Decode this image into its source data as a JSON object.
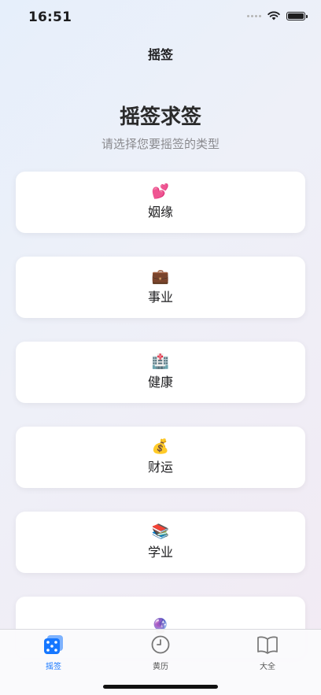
{
  "status_bar": {
    "time": "16:51"
  },
  "nav": {
    "title": "摇签"
  },
  "hero": {
    "title": "摇签求签",
    "subtitle": "请选择您要摇签的类型"
  },
  "categories": [
    {
      "emoji": "💕",
      "label": "姻缘"
    },
    {
      "emoji": "💼",
      "label": "事业"
    },
    {
      "emoji": "🏥",
      "label": "健康"
    },
    {
      "emoji": "💰",
      "label": "财运"
    },
    {
      "emoji": "📚",
      "label": "学业"
    },
    {
      "emoji": "🔮",
      "label": ""
    }
  ],
  "tab_bar": {
    "tabs": [
      {
        "label": "摇签",
        "icon": "dice-icon",
        "active": true
      },
      {
        "label": "黄历",
        "icon": "clock-icon",
        "active": false
      },
      {
        "label": "大全",
        "icon": "book-icon",
        "active": false
      }
    ],
    "accent": "#1677ff"
  }
}
